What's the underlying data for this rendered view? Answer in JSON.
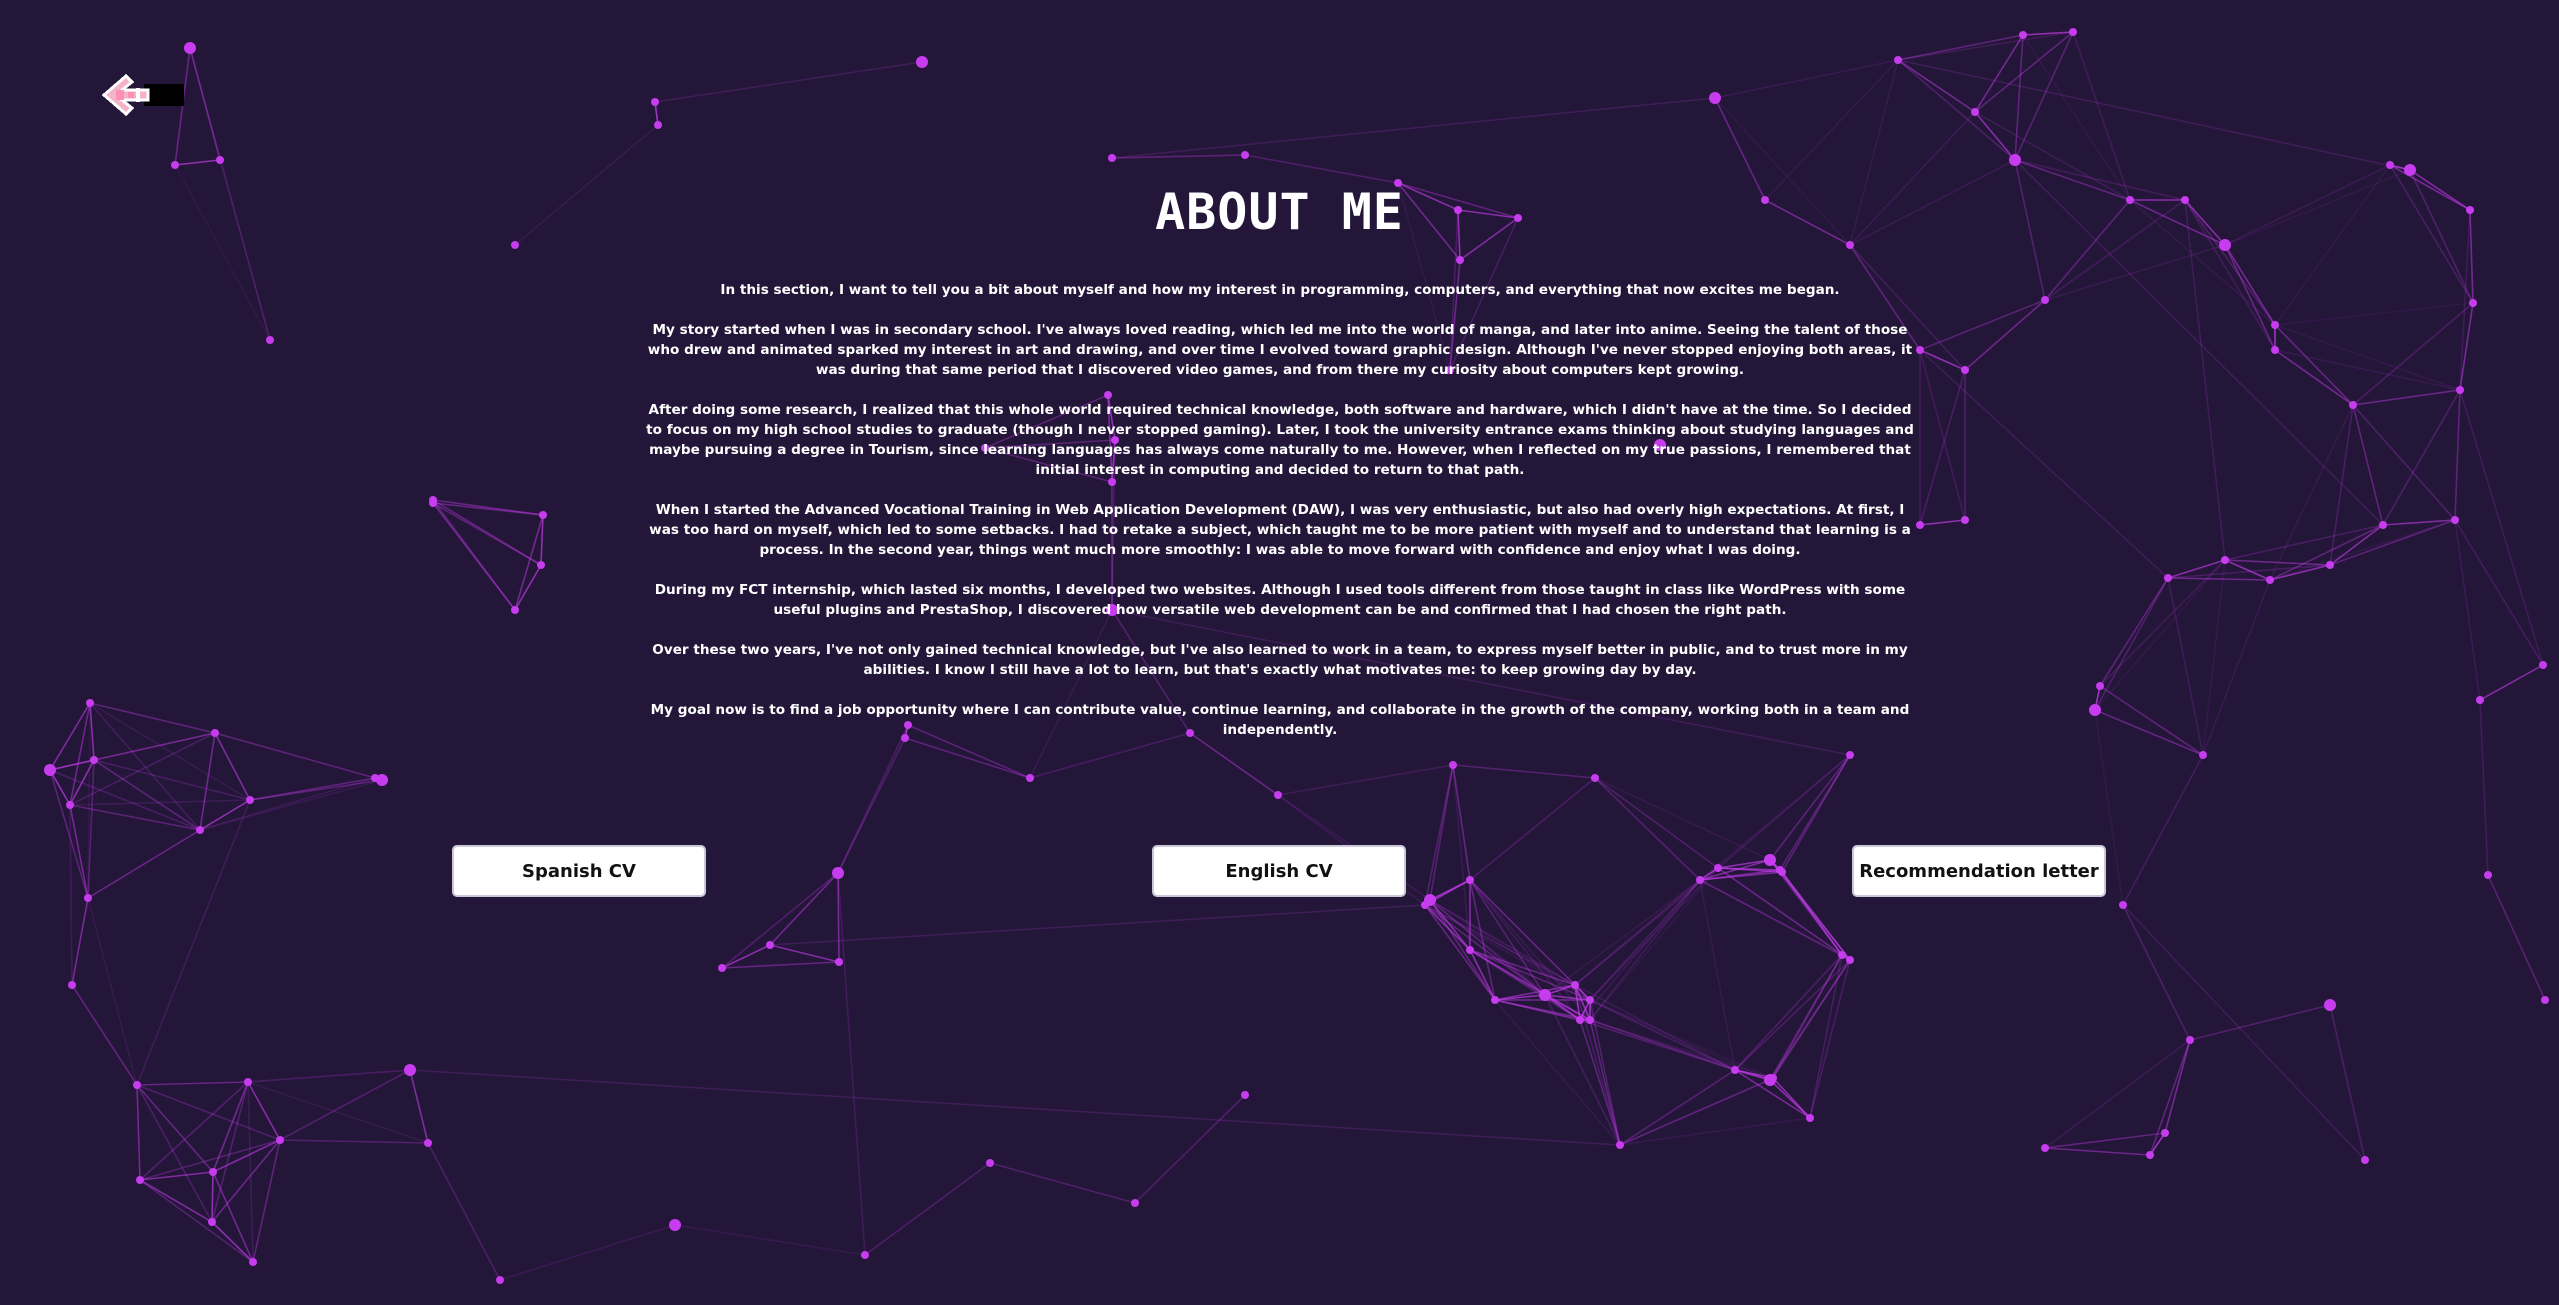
{
  "page": {
    "title": "ABOUT ME",
    "paragraphs": [
      "In this section, I want to tell you a bit about myself and how my interest in programming, computers, and everything that now excites me began.",
      "My story started when I was in secondary school. I've always loved reading, which led me into the world of manga, and later into anime. Seeing the talent of those who drew and animated sparked my interest in art and drawing, and over time I evolved toward graphic design. Although I've never stopped enjoying both areas, it was during that same period that I discovered video games, and from there my curiosity about computers kept growing.",
      "After doing some research, I realized that this whole world required technical knowledge, both software and hardware, which I didn't have at the time. So I decided to focus on my high school studies to graduate (though I never stopped gaming). Later, I took the university entrance exams thinking about studying languages and maybe pursuing a degree in Tourism, since learning languages has always come naturally to me. However, when I reflected on my true passions, I remembered that initial interest in computing and decided to return to that path.",
      "When I started the Advanced Vocational Training in Web Application Development (DAW), I was very enthusiastic, but also had overly high expectations. At first, I was too hard on myself, which led to some setbacks. I had to retake a subject, which taught me to be more patient with myself and to understand that learning is a process. In the second year, things went much more smoothly: I was able to move forward with confidence and enjoy what I was doing.",
      "During my FCT internship, which lasted six months, I developed two websites. Although I used tools different from those taught in class like WordPress with some useful plugins and PrestaShop, I discovered how versatile web development can be and confirmed that I had chosen the right path.",
      "Over these two years, I've not only gained technical knowledge, but I've also learned to work in a team, to express myself better in public, and to trust more in my abilities. I know I still have a lot to learn, but that's exactly what motivates me: to keep growing day by day.",
      "My goal now is to find a job opportunity where I can contribute value, continue learning, and collaborate in the growth of the company, working both in a team and independently."
    ]
  },
  "buttons": {
    "spanish_cv": "Spanish CV",
    "english_cv": "English CV",
    "recommendation": "Recommendation letter"
  },
  "icons": {
    "back": "pixel-arrow-back-icon"
  },
  "colors": {
    "background": "#231638",
    "accent": "#c83cf0",
    "text": "#ffffff",
    "button_bg": "#ffffff",
    "button_text": "#111111"
  }
}
